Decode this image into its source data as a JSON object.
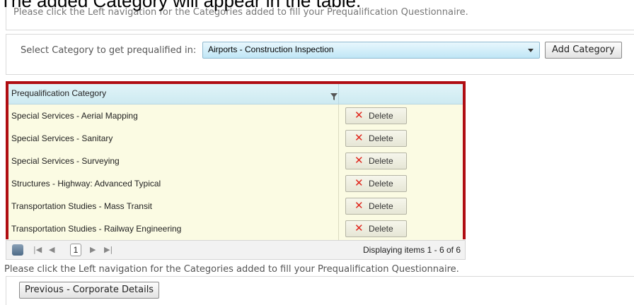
{
  "caption": "The added Category will appear in the table.",
  "top_panel": {
    "note": "Please click the Left navigation for the Categories added to fill your Prequalification Questionnaire."
  },
  "category_select": {
    "label": "Select Category to get prequalified in:",
    "selected_value": "Airports - Construction Inspection",
    "add_button_label": "Add Category"
  },
  "grid": {
    "columns": [
      "Prequalification Category",
      ""
    ],
    "rows": [
      {
        "category": "Special Services - Aerial Mapping",
        "action": "Delete"
      },
      {
        "category": "Special Services - Sanitary",
        "action": "Delete"
      },
      {
        "category": "Special Services - Surveying",
        "action": "Delete"
      },
      {
        "category": "Structures - Highway: Advanced Typical",
        "action": "Delete"
      },
      {
        "category": "Transportation Studies - Mass Transit",
        "action": "Delete"
      },
      {
        "category": "Transportation Studies - Railway Engineering",
        "action": "Delete"
      }
    ],
    "highlight_color": "#b00d12"
  },
  "pager": {
    "current_page": "1",
    "info": "Displaying items 1 - 6 of 6"
  },
  "bottom_note": "Please click the Left navigation for the Categories added to fill your Prequalification Questionnaire.",
  "previous_button_label": "Previous - Corporate Details",
  "icons": {
    "delete": "x-icon",
    "filter": "filter-icon",
    "refresh": "refresh-icon"
  }
}
